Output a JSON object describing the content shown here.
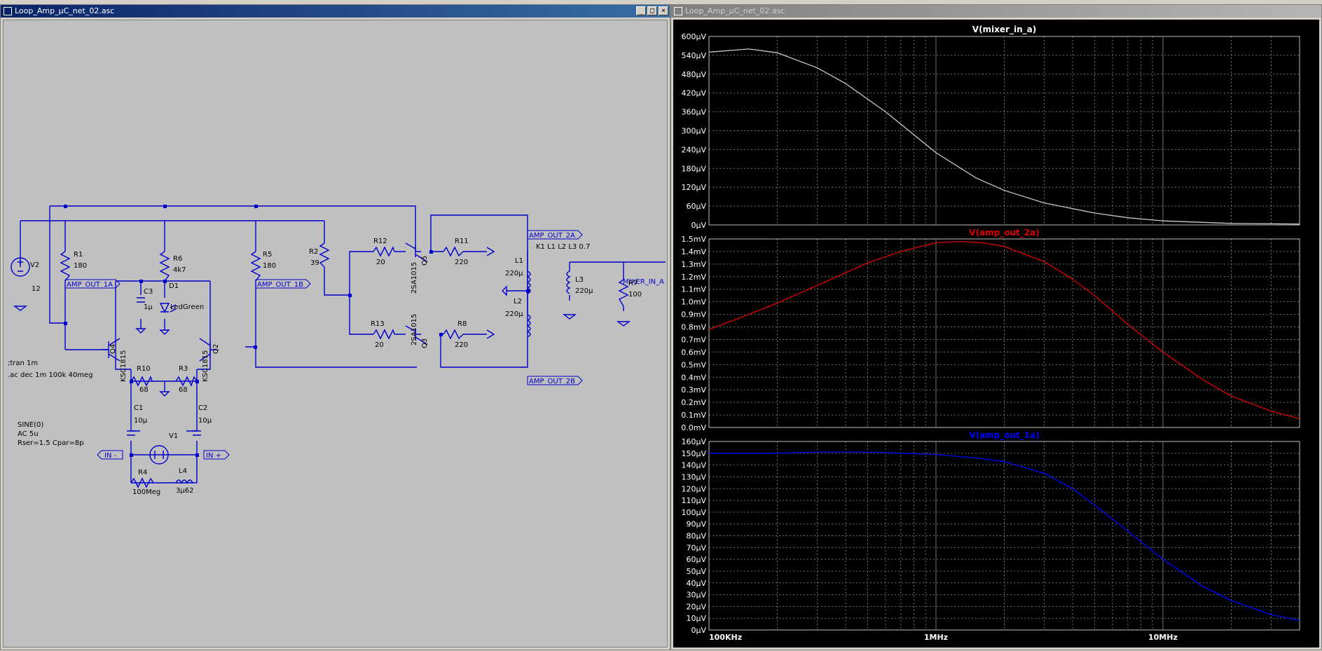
{
  "schematic_window": {
    "title": "Loop_Amp_µC_net_02.asc",
    "buttons": {
      "minimize": "_",
      "maximize": "□",
      "close": "×"
    }
  },
  "plot_window": {
    "title": "Loop_Amp_µC_net_02.asc"
  },
  "schematic": {
    "directives": [
      ";tran 1m",
      ".ac dec 1m 100k 40meg"
    ],
    "source_params": [
      "SINE(0)",
      "AC 5u",
      "Rser=1.5 Cpar=8p"
    ],
    "coupling": "K1 L1 L2 L3 0.7",
    "labels": {
      "v2_name": "V2",
      "v2_value": "12",
      "r1_name": "R1",
      "r1_value": "180",
      "r6_name": "R6",
      "r6_value": "4k7",
      "r5_name": "R5",
      "r5_value": "180",
      "r2_name": "R2",
      "r2_value": "39",
      "r12_name": "R12",
      "r12_value": "20",
      "r13_name": "R13",
      "r13_value": "20",
      "r11_name": "R11",
      "r11_value": "220",
      "r8_name": "R8",
      "r8_value": "220",
      "r10_name": "R10",
      "r10_value": "68",
      "r3_name": "R3",
      "r3_value": "68",
      "r4_name": "R4",
      "r4_value": "100Meg",
      "r7_name": "R7",
      "r7_value": "100",
      "c3_name": "C3",
      "c3_value": "1µ",
      "c1_name": "C1",
      "c1_value": "10µ",
      "c2_name": "C2",
      "c2_value": "10µ",
      "d1_name": "D1",
      "d1_value": "LedGreen",
      "l1_name": "L1",
      "l1_value": "220µ",
      "l2_name": "L2",
      "l2_value": "220µ",
      "l3_name": "L3",
      "l3_value": "220µ",
      "l4_name": "L4",
      "l4_value": "3µ62",
      "q4_name": "Q4",
      "q4_value": "KSC1815",
      "q2_name": "Q2",
      "q2_value": "KSC1815",
      "q5_name": "Q5",
      "q5_value": "2SA1015",
      "q3_name": "Q3",
      "q3_value": "2SA1015",
      "v1_name": "V1"
    },
    "net_labels": {
      "amp_out_1a": "AMP_OUT_1A",
      "amp_out_1b": "AMP_OUT_1B",
      "amp_out_2a": "AMP_OUT_2A",
      "amp_out_2b": "AMP_OUT_2B",
      "mixer_in_a": "MIXER_IN_A",
      "in_minus": "IN -",
      "in_plus": "IN +"
    }
  },
  "colors": {
    "schematic_wire": "#0000cc",
    "plot_bg": "#000000",
    "grid": "#707070",
    "trace_mixer": "#c8c8c8",
    "trace_amp2a": "#e00000",
    "trace_amp1a": "#0000ff",
    "axis_text": "#ffffff"
  },
  "chart_data": [
    {
      "type": "line",
      "title": "V(mixer_in_a)",
      "xlabel": "",
      "ylabel": "",
      "x_scale": "log",
      "xlim_hz": [
        100000,
        40000000
      ],
      "ylim": [
        0,
        600
      ],
      "y_unit": "µV",
      "y_ticks": [
        "0µV",
        "60µV",
        "120µV",
        "180µV",
        "240µV",
        "300µV",
        "360µV",
        "420µV",
        "480µV",
        "540µV",
        "600µV"
      ],
      "grid": true,
      "series": [
        {
          "color": "#c8c8c8",
          "x": [
            100000,
            150000,
            200000,
            300000,
            400000,
            600000,
            1000000,
            1500000,
            2000000,
            3000000,
            5000000,
            7000000,
            10000000,
            20000000,
            40000000
          ],
          "y": [
            550,
            560,
            548,
            500,
            450,
            360,
            230,
            150,
            110,
            70,
            38,
            23,
            13,
            5,
            3
          ]
        }
      ]
    },
    {
      "type": "line",
      "title": "V(amp_out_2a)",
      "xlabel": "",
      "ylabel": "",
      "x_scale": "log",
      "xlim_hz": [
        100000,
        40000000
      ],
      "ylim": [
        0,
        1.5
      ],
      "y_unit": "mV",
      "y_ticks": [
        "0.0mV",
        "0.1mV",
        "0.2mV",
        "0.3mV",
        "0.4mV",
        "0.5mV",
        "0.6mV",
        "0.7mV",
        "0.8mV",
        "0.9mV",
        "1.0mV",
        "1.1mV",
        "1.2mV",
        "1.3mV",
        "1.4mV",
        "1.5mV"
      ],
      "grid": true,
      "series": [
        {
          "color": "#e00000",
          "x": [
            100000,
            150000,
            200000,
            300000,
            500000,
            700000,
            1000000,
            1300000,
            1600000,
            2000000,
            3000000,
            4000000,
            5000000,
            7000000,
            10000000,
            15000000,
            20000000,
            30000000,
            40000000
          ],
          "y": [
            0.78,
            0.9,
            0.99,
            1.13,
            1.31,
            1.4,
            1.47,
            1.48,
            1.47,
            1.44,
            1.32,
            1.18,
            1.05,
            0.82,
            0.6,
            0.38,
            0.25,
            0.13,
            0.07
          ]
        }
      ]
    },
    {
      "type": "line",
      "title": "V(amp_out_1a)",
      "xlabel": "",
      "ylabel": "",
      "x_scale": "log",
      "xlim_hz": [
        100000,
        40000000
      ],
      "ylim": [
        0,
        160
      ],
      "y_unit": "µV",
      "y_ticks": [
        "0µV",
        "10µV",
        "20µV",
        "30µV",
        "40µV",
        "50µV",
        "60µV",
        "70µV",
        "80µV",
        "90µV",
        "100µV",
        "110µV",
        "120µV",
        "130µV",
        "140µV",
        "150µV",
        "160µV"
      ],
      "x_ticks": [
        {
          "v": 100000,
          "label": "100KHz"
        },
        {
          "v": 1000000,
          "label": "1MHz"
        },
        {
          "v": 10000000,
          "label": "10MHz"
        }
      ],
      "grid": true,
      "series": [
        {
          "color": "#0000ff",
          "x": [
            100000,
            200000,
            300000,
            500000,
            1000000,
            1500000,
            2000000,
            3000000,
            4000000,
            5000000,
            7000000,
            10000000,
            15000000,
            20000000,
            30000000,
            40000000
          ],
          "y": [
            150,
            150,
            151,
            151,
            149,
            146,
            143,
            133,
            120,
            106,
            84,
            60,
            37,
            25,
            13,
            8
          ]
        }
      ]
    }
  ]
}
